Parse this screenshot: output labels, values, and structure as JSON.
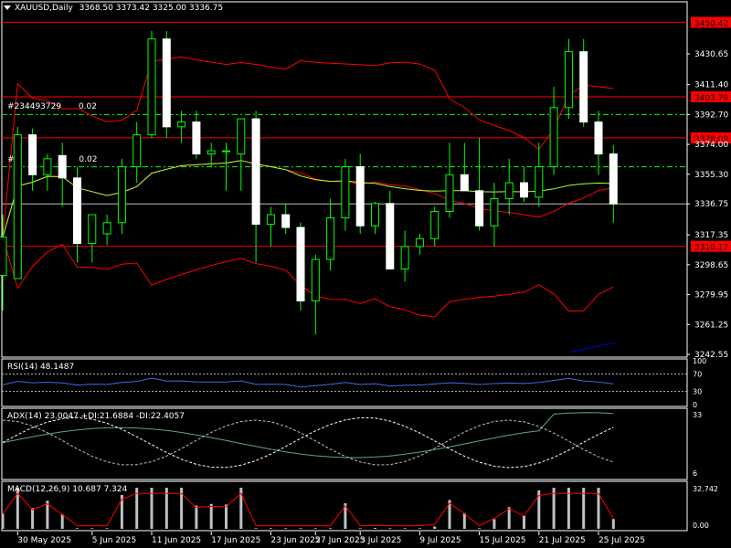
{
  "header": {
    "symbol_tf": "XAUUSD,Daily",
    "ohlc": "3368.50 3373.42 3325.00 3336.75"
  },
  "orders": [
    {
      "label": "#234493729",
      "value": "0.02"
    },
    {
      "label": "#",
      "value": "0.02"
    }
  ],
  "price_axis": {
    "ticks": [
      "3430.65",
      "3411.40",
      "3392.70",
      "3374.00",
      "3355.30",
      "3336.75",
      "3317.35",
      "3298.65",
      "3279.95",
      "3261.25",
      "3242.55"
    ],
    "levels": [
      {
        "price": 3450.42,
        "label": "3450.42",
        "color": "#ff0000"
      },
      {
        "price": 3403.79,
        "label": "3403.79",
        "color": "#ff0000"
      },
      {
        "price": 3378.09,
        "label": "3378.09",
        "color": "#ff0000"
      },
      {
        "price": 3310.17,
        "label": "3310.17",
        "color": "#ff0000"
      }
    ],
    "current_price": {
      "price": 3336.75,
      "label": "3336.75"
    },
    "dash_levels": [
      3392.7,
      3360.0
    ]
  },
  "date_axis": [
    "30 May 2025",
    "5 Jun 2025",
    "11 Jun 2025",
    "17 Jun 2025",
    "23 Jun 2025",
    "27 Jun 2025",
    "3 Jul 2025",
    "9 Jul 2025",
    "15 Jul 2025",
    "21 Jul 2025",
    "25 Jul 2025"
  ],
  "rsi_panel": {
    "title": "RSI(14) 48.1487",
    "axis": [
      "100",
      "70",
      "30",
      "0"
    ]
  },
  "adx_panel": {
    "title": "ADX(14) 23.0047 +DI:21.6884 -DI:22.4057",
    "axis": [
      "33",
      "6"
    ]
  },
  "macd_panel": {
    "title": "MACD(12,26,9) 10.687 7.324",
    "axis": [
      "32.742",
      "0.00"
    ]
  },
  "colors": {
    "bull": "#ffffff",
    "bear": "#ffffff",
    "wick": "#00ff00",
    "bands": "#ff0000",
    "ma": "#adff2f",
    "rsi": "#4169e1",
    "adx": "#5f9ea0",
    "macd_signal": "#ff0000",
    "macd_hist": "#c0c0c0",
    "trend": "#0000cd"
  },
  "chart_data": {
    "type": "candlestick",
    "x": [
      "2025-05-29",
      "2025-05-30",
      "2025-06-02",
      "2025-06-03",
      "2025-06-04",
      "2025-06-05",
      "2025-06-06",
      "2025-06-09",
      "2025-06-10",
      "2025-06-11",
      "2025-06-12",
      "2025-06-13",
      "2025-06-16",
      "2025-06-17",
      "2025-06-18",
      "2025-06-19",
      "2025-06-20",
      "2025-06-23",
      "2025-06-24",
      "2025-06-25",
      "2025-06-26",
      "2025-06-27",
      "2025-06-30",
      "2025-07-01",
      "2025-07-02",
      "2025-07-03",
      "2025-07-04",
      "2025-07-07",
      "2025-07-08",
      "2025-07-09",
      "2025-07-10",
      "2025-07-11",
      "2025-07-14",
      "2025-07-15",
      "2025-07-16",
      "2025-07-17",
      "2025-07-18",
      "2025-07-21",
      "2025-07-22",
      "2025-07-23",
      "2025-07-24",
      "2025-07-25"
    ],
    "ohlc": [
      [
        3292,
        3330,
        3270,
        3316
      ],
      [
        3290,
        3385,
        3290,
        3380
      ],
      [
        3380,
        3384,
        3345,
        3355
      ],
      [
        3355,
        3368,
        3345,
        3365
      ],
      [
        3367,
        3375,
        3335,
        3353
      ],
      [
        3353,
        3360,
        3300,
        3312
      ],
      [
        3312,
        3330,
        3300,
        3330
      ],
      [
        3318,
        3330,
        3311,
        3325
      ],
      [
        3325,
        3365,
        3318,
        3360
      ],
      [
        3360,
        3388,
        3350,
        3380
      ],
      [
        3380,
        3445,
        3378,
        3440
      ],
      [
        3440,
        3445,
        3378,
        3385
      ],
      [
        3385,
        3395,
        3375,
        3388
      ],
      [
        3388,
        3395,
        3365,
        3368
      ],
      [
        3368,
        3375,
        3360,
        3370
      ],
      [
        3370,
        3375,
        3345,
        3370
      ],
      [
        3368,
        3390,
        3345,
        3390
      ],
      [
        3390,
        3395,
        3300,
        3324
      ],
      [
        3324,
        3335,
        3310,
        3330
      ],
      [
        3330,
        3337,
        3318,
        3322
      ],
      [
        3322,
        3325,
        3270,
        3276
      ],
      [
        3276,
        3305,
        3255,
        3302
      ],
      [
        3302,
        3340,
        3295,
        3328
      ],
      [
        3328,
        3365,
        3320,
        3360
      ],
      [
        3360,
        3368,
        3318,
        3323
      ],
      [
        3323,
        3338,
        3318,
        3337
      ],
      [
        3337,
        3345,
        3298,
        3296
      ],
      [
        3296,
        3320,
        3288,
        3310
      ],
      [
        3310,
        3318,
        3305,
        3315
      ],
      [
        3315,
        3335,
        3310,
        3332
      ],
      [
        3332,
        3375,
        3328,
        3355
      ],
      [
        3355,
        3375,
        3345,
        3345
      ],
      [
        3345,
        3378,
        3320,
        3323
      ],
      [
        3323,
        3350,
        3310,
        3340
      ],
      [
        3340,
        3365,
        3330,
        3350
      ],
      [
        3350,
        3360,
        3338,
        3341
      ],
      [
        3341,
        3375,
        3335,
        3360
      ],
      [
        3360,
        3410,
        3355,
        3397
      ],
      [
        3397,
        3440,
        3390,
        3432
      ],
      [
        3432,
        3440,
        3385,
        3388
      ],
      [
        3388,
        3395,
        3355,
        3368
      ],
      [
        3368,
        3373.42,
        3325,
        3336.75
      ]
    ],
    "series": [
      {
        "name": "ADX(14)",
        "values": [
          23.0047
        ]
      },
      {
        "name": "+DI",
        "values": [
          21.6884
        ]
      },
      {
        "name": "-DI",
        "values": [
          22.4057
        ]
      },
      {
        "name": "RSI(14)",
        "values": [
          48.1487
        ]
      },
      {
        "name": "MACD(12,26,9)",
        "values": [
          10.687,
          7.324
        ]
      }
    ],
    "ylim": [
      3235,
      3455
    ]
  }
}
